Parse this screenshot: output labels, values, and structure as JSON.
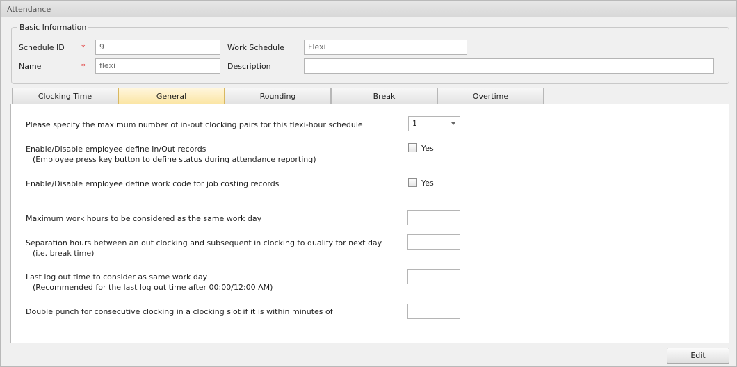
{
  "window": {
    "title": "Attendance"
  },
  "basic_info": {
    "legend": "Basic Information",
    "schedule_id_label": "Schedule ID",
    "schedule_id_value": "9",
    "name_label": "Name",
    "name_value": "flexi",
    "required_mark": "*",
    "work_schedule_label": "Work Schedule",
    "work_schedule_value": "Flexi",
    "description_label": "Description",
    "description_value": ""
  },
  "tabs": [
    {
      "label": "Clocking Time",
      "active": false
    },
    {
      "label": "General",
      "active": true
    },
    {
      "label": "Rounding",
      "active": false
    },
    {
      "label": "Break",
      "active": false
    },
    {
      "label": "Overtime",
      "active": false
    }
  ],
  "general": {
    "max_pairs_label": "Please specify the maximum number of in-out clocking pairs for this flexi-hour schedule",
    "max_pairs_value": "1",
    "inout_label": "Enable/Disable employee define In/Out records",
    "inout_sub": "(Employee press key button to define status during attendance reporting)",
    "inout_checkbox_label": "Yes",
    "inout_checked": false,
    "workcode_label": "Enable/Disable employee define work code for job costing records",
    "workcode_checkbox_label": "Yes",
    "workcode_checked": false,
    "max_hours_label": "Maximum work hours to be considered as the same work day",
    "max_hours_value": "",
    "separation_label": "Separation hours between an out clocking and subsequent in clocking to qualify for next day",
    "separation_sub": "(i.e. break time)",
    "separation_value": "",
    "last_logout_label": "Last log out time to consider as same work day",
    "last_logout_sub": "(Recommended for the last log out time after 00:00/12:00 AM)",
    "last_logout_value": "",
    "double_punch_label": "Double punch for consecutive clocking in a clocking slot if it is within minutes of",
    "double_punch_value": ""
  },
  "footer": {
    "edit_label": "Edit"
  }
}
